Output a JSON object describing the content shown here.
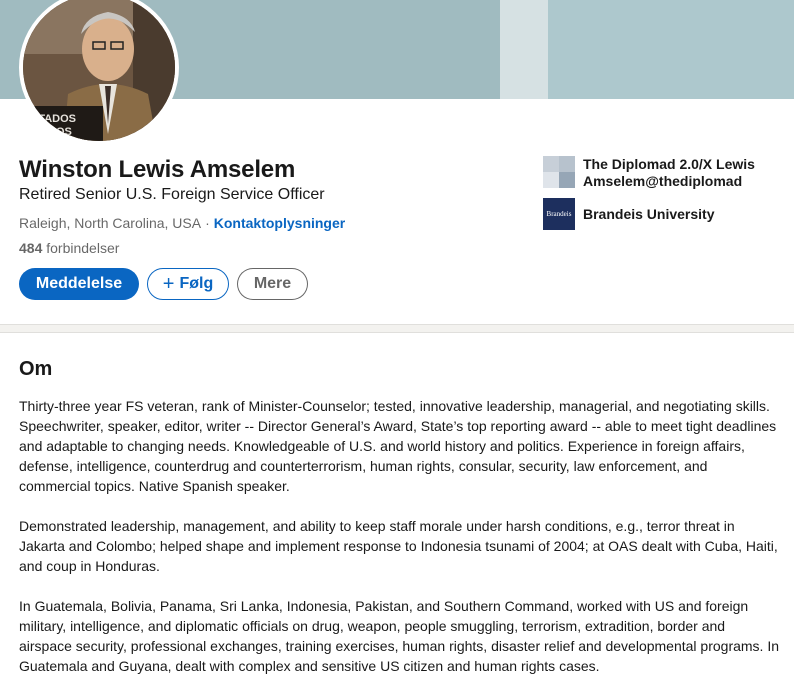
{
  "profile": {
    "name": "Winston Lewis Amselem",
    "headline": "Retired Senior U.S. Foreign Service Officer",
    "location": "Raleigh, North Carolina, USA",
    "separator": "·",
    "contact_link": "Kontaktoplysninger",
    "connections_count": "484",
    "connections_label": "forbindelser",
    "avatar_text": "STADOS\nNIDOS"
  },
  "actions": {
    "message": "Meddelelse",
    "follow_plus": "+",
    "follow": "Følg",
    "more": "Mere"
  },
  "side": {
    "company": "The Diplomad 2.0/X Lewis Amselem@thediplomad",
    "company_line1": "The Diplomad 2.0/X Lewis",
    "company_line2": "Amselem@thediplomad",
    "school": "Brandeis University",
    "school_logo_text": "Brandeis"
  },
  "about": {
    "title": "Om",
    "paragraphs": [
      "Thirty-three year FS veteran, rank of Minister-Counselor; tested, innovative leadership, managerial, and negotiating skills. Speechwriter, speaker, editor, writer -- Director General’s Award, State’s top reporting award -- able to meet tight deadlines and adaptable to changing needs. Knowledgeable of U.S. and world history and politics. Experience in foreign affairs, defense, intelligence, counterdrug and counterterrorism, human rights, consular, security, law enforcement, and commercial topics. Native Spanish speaker.",
      "Demonstrated leadership, management, and ability to keep staff morale under harsh conditions, e.g., terror threat in Jakarta and Colombo; helped shape and implement response to Indonesia tsunami of 2004; at OAS dealt with Cuba, Haiti, and coup in Honduras.",
      "In Guatemala, Bolivia, Panama, Sri Lanka, Indonesia, Pakistan, and Southern Command, worked with US and foreign military, intelligence, and diplomatic officials on drug, weapon, people smuggling, terrorism, extradition, border and airspace security, professional exchanges, training exercises, human rights, disaster relief and developmental programs. In Guatemala and Guyana, dealt with complex and sensitive US citizen and human rights cases."
    ]
  },
  "colors": {
    "primary": "#0a66c2",
    "banner": "#a9c1c6",
    "page_bg": "#f3f2ef"
  }
}
